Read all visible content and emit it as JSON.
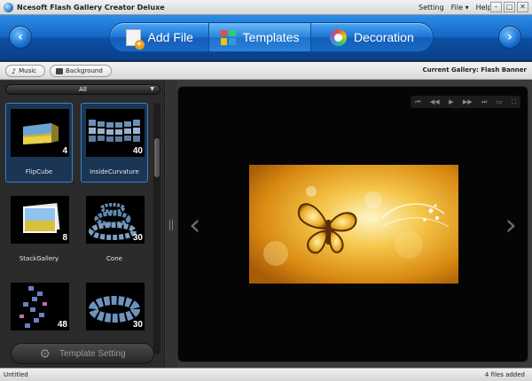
{
  "window": {
    "title": "Ncesoft Flash Gallery Creator Deluxe"
  },
  "menu": {
    "items": [
      "Setting",
      "File ▾",
      "Help"
    ]
  },
  "window_controls": [
    "–",
    "□",
    "✕"
  ],
  "toolbar": {
    "tabs": [
      {
        "label": "Add File",
        "icon": "add-file-icon"
      },
      {
        "label": "Templates",
        "icon": "templates-icon",
        "active": true
      },
      {
        "label": "Decoration",
        "icon": "decoration-icon"
      }
    ],
    "prev_icon": "‹",
    "next_icon": "›"
  },
  "subbar": {
    "music_label": "Music",
    "background_label": "Background",
    "current_gallery": "Current Gallery: Flash Banner"
  },
  "templates": {
    "filter_value": "All",
    "items": [
      {
        "name": "FlipCube",
        "count": "4",
        "selected": true
      },
      {
        "name": "InsideCurvature",
        "count": "40",
        "selected": true
      },
      {
        "name": "StackGallery",
        "count": "8",
        "selected": false
      },
      {
        "name": "Cone",
        "count": "30",
        "selected": false
      },
      {
        "name": "",
        "count": "48",
        "selected": false
      },
      {
        "name": "",
        "count": "30",
        "selected": false
      }
    ],
    "setting_button": "Template Setting"
  },
  "preview": {
    "controls": [
      "⏮",
      "◀◀",
      "▶",
      "▶▶",
      "⏭",
      "▭",
      "⛶"
    ],
    "prev_arrow": "‹",
    "next_arrow": "›"
  },
  "status": {
    "left": "Untitled",
    "right": "4 files added"
  },
  "colors": {
    "toolbar_blue": "#1566c2",
    "selected_border": "#3d7fc8",
    "panel_dark": "#2b2b2b"
  }
}
